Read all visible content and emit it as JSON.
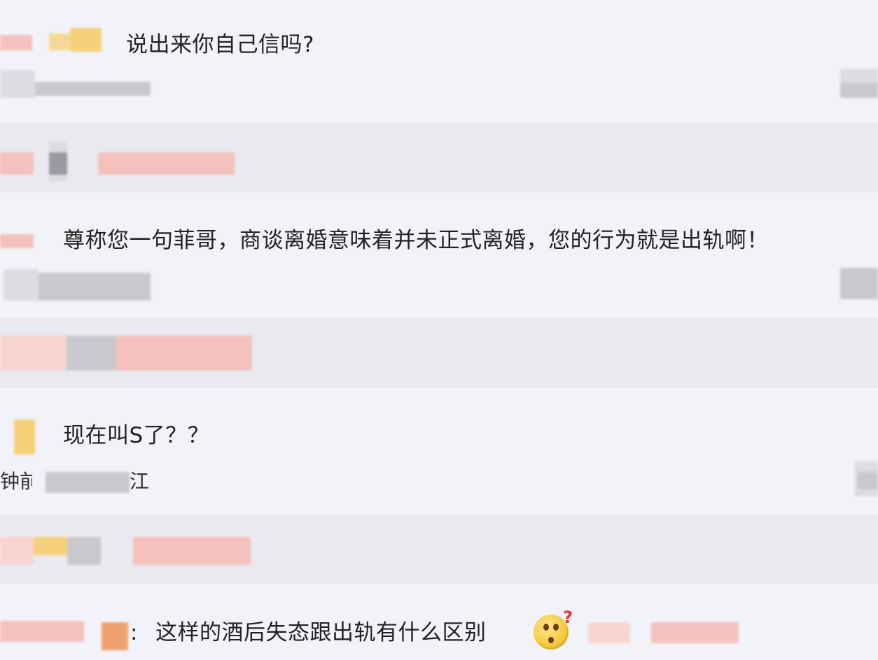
{
  "comments": [
    {
      "text": "说出来你自己信吗?"
    },
    {
      "text": "尊称您一句菲哥，商谈离婚意味着并未正式离婚，您的行为就是出轨啊！"
    },
    {
      "text": "现在叫S了？？",
      "meta_fragment_left": "钟前",
      "meta_fragment_right": "江"
    },
    {
      "text": "这样的酒后失态跟出轨有什么区别",
      "prefix_colon": ":"
    }
  ],
  "icons": {
    "emoji": "confused-emoji-icon"
  },
  "colors": {
    "background": "#f2f3f8",
    "band": "#e9eaef",
    "mosaic_pink": "#f4c1bc",
    "mosaic_gray": "#c9c9cd",
    "mosaic_yellow": "#f6cf7a"
  }
}
